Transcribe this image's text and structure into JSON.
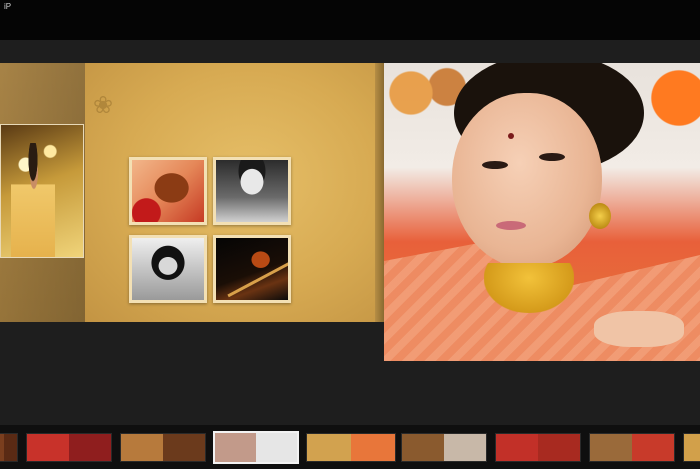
{
  "status_bar": {
    "device_label": "iP"
  },
  "album": {
    "left_page": {
      "photo": "bride-portrait-left"
    },
    "center_page": {
      "thumbnails": [
        {
          "name": "henna-hands-photo"
        },
        {
          "name": "groom-portrait-photo"
        },
        {
          "name": "bride-veil-photo"
        },
        {
          "name": "violin-photo"
        }
      ]
    },
    "right_page": {
      "photo": "bride-closeup-photo"
    }
  },
  "filmstrip": {
    "selected_index": 3,
    "spreads": [
      {
        "name": "spread-1",
        "left_color": "#7a3e1e",
        "right_color": "#5a2a14"
      },
      {
        "name": "spread-2",
        "left_color": "#c8322a",
        "right_color": "#8f1e1e"
      },
      {
        "name": "spread-3",
        "left_color": "#b77a3c",
        "right_color": "#6b3a1c"
      },
      {
        "name": "spread-4",
        "left_color": "#c29a8a",
        "right_color": "#e6e6e6"
      },
      {
        "name": "spread-5",
        "left_color": "#d2a24f",
        "right_color": "#e8763a"
      },
      {
        "name": "spread-6",
        "left_color": "#8a5a2e",
        "right_color": "#c8b8a8"
      },
      {
        "name": "spread-7",
        "left_color": "#c23028",
        "right_color": "#a82a20"
      },
      {
        "name": "spread-8",
        "left_color": "#9a6a3a",
        "right_color": "#c83a2a"
      },
      {
        "name": "spread-9",
        "left_color": "#d2a04a",
        "right_color": "#b87a3a"
      }
    ]
  }
}
